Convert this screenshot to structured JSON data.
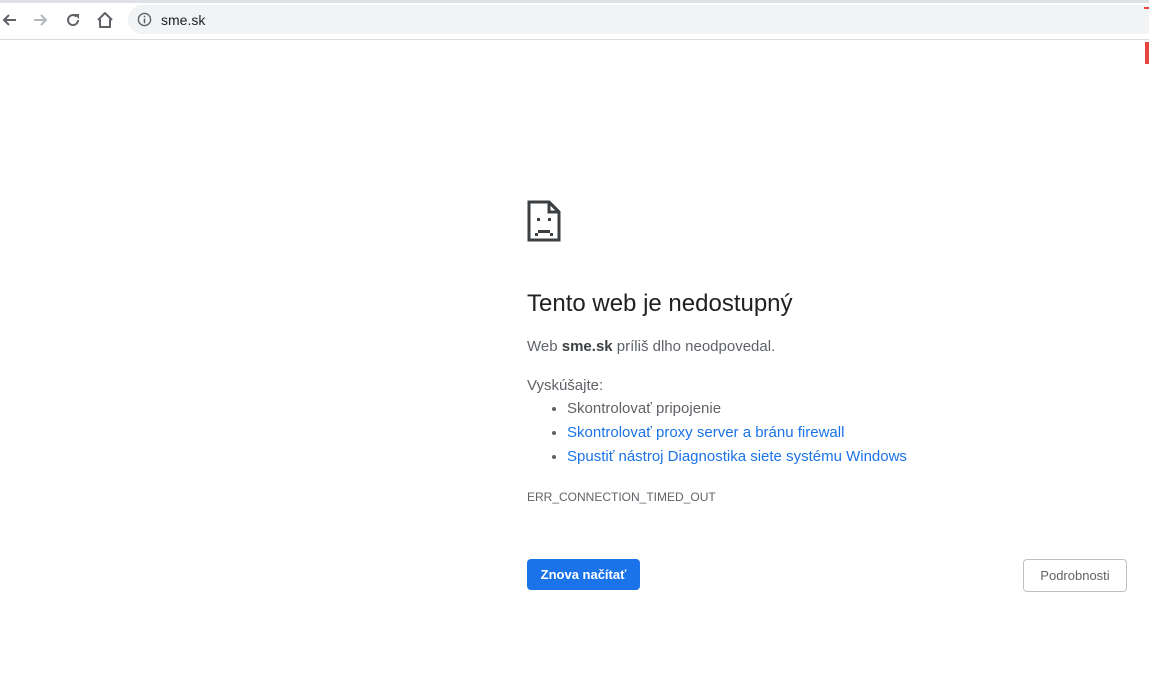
{
  "browser": {
    "url": "sme.sk",
    "icons": {
      "back": "back-arrow-icon",
      "forward": "forward-arrow-icon",
      "reload": "reload-icon",
      "home": "home-icon",
      "info": "info-icon"
    }
  },
  "error": {
    "icon": "sad-page-icon",
    "title": "Tento web je nedostupný",
    "message_prefix": "Web ",
    "host": "sme.sk",
    "message_suffix": " príliš dlho neodpovedal.",
    "try_label": "Vyskúšajte:",
    "suggestions": [
      "Skontrolovať pripojenie",
      "Skontrolovať proxy server a bránu firewall",
      "Spustiť nástroj Diagnostika siete systému Windows"
    ],
    "code": "ERR_CONNECTION_TIMED_OUT",
    "reload_label": "Znova načítať",
    "details_label": "Podrobnosti"
  },
  "colors": {
    "accent": "#1a73e8",
    "text": "#202124",
    "secondary_text": "#5f6368"
  }
}
